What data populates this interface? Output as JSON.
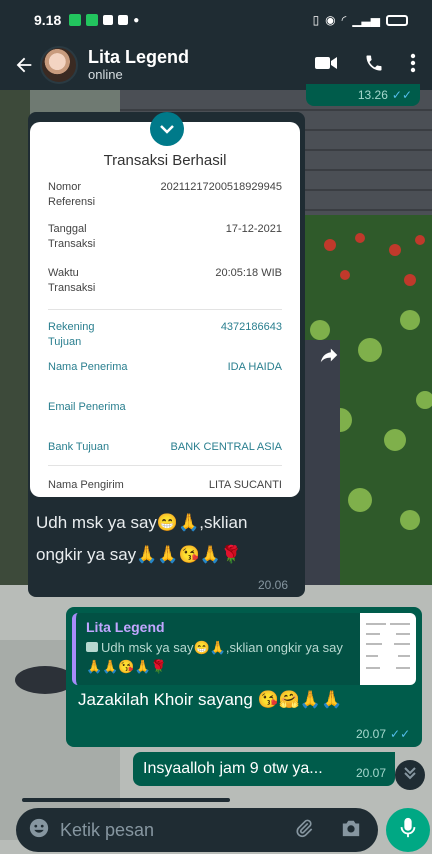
{
  "status_bar": {
    "time": "9.18"
  },
  "header": {
    "contact_name": "Lita Legend",
    "status": "online"
  },
  "top_message": {
    "time": "13.26"
  },
  "receipt": {
    "title": "Transaksi Berhasil",
    "rows": [
      {
        "label": "Nomor Referensi",
        "value": "20211217200518929945"
      },
      {
        "label": "Tanggal Transaksi",
        "value": "17-12-2021"
      },
      {
        "label": "Waktu Transaksi",
        "value": "20:05:18 WIB"
      },
      {
        "label": "Rekening Tujuan",
        "value": "4372186643"
      },
      {
        "label": "Nama Penerima",
        "value": "IDA HAIDA"
      },
      {
        "label": "Email Penerima",
        "value": ""
      },
      {
        "label": "Bank Tujuan",
        "value": "BANK CENTRAL ASIA"
      },
      {
        "label": "Nama Pengirim",
        "value": "LITA SUCANTI"
      }
    ]
  },
  "incoming_message": {
    "line1": "Udh msk ya say😁🙏,sklian",
    "line2": "ongkir ya say🙏🙏😘🙏🌹",
    "time": "20.06"
  },
  "reply_message": {
    "quote_author": "Lita Legend",
    "quote_text": "Udh msk ya say😁🙏,sklian ongkir ya say🙏🙏😘🙏🌹",
    "text": "Jazakilah Khoir sayang 😘🤗🙏🙏",
    "time": "20.07"
  },
  "last_message": {
    "text": "Insyaalloh jam 9 otw ya...",
    "time": "20.07"
  },
  "composer": {
    "placeholder": "Ketik pesan"
  }
}
